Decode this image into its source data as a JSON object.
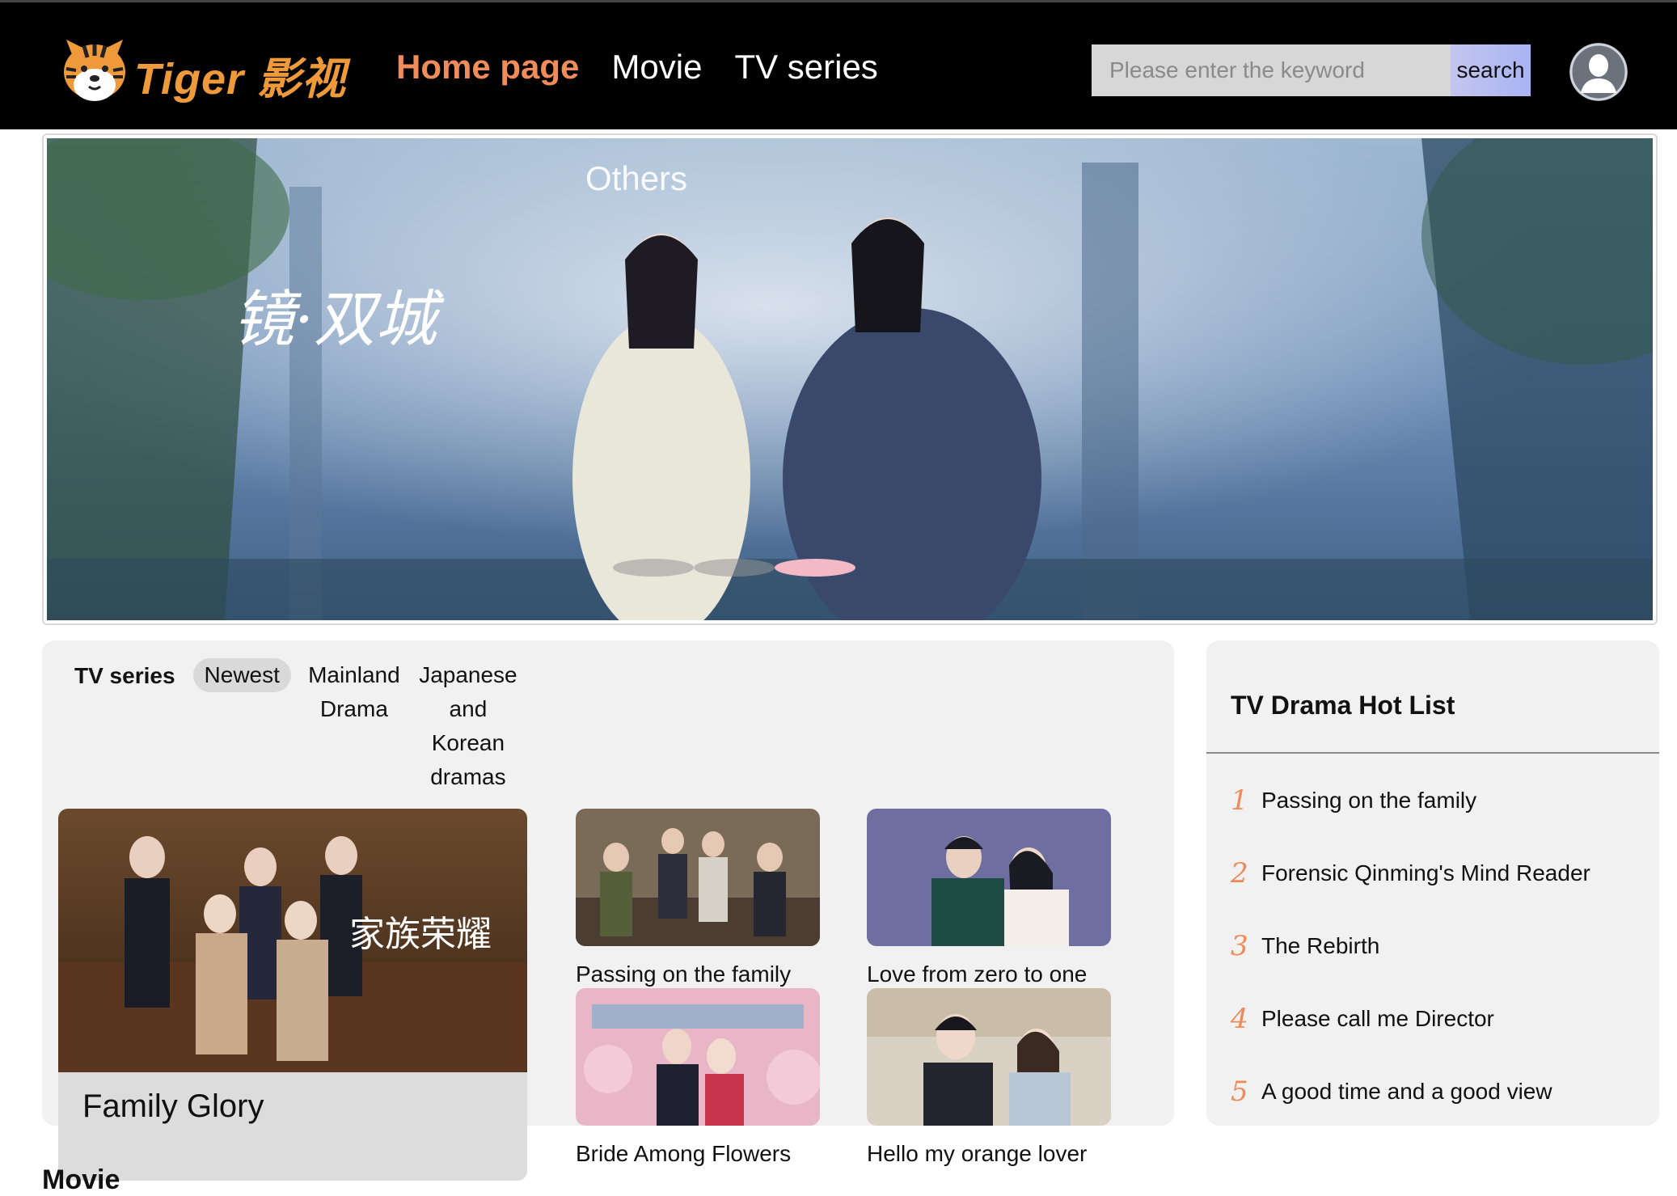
{
  "header": {
    "logo_text": "Tiger 影视",
    "nav": [
      {
        "label": "Home page",
        "active": true
      },
      {
        "label": "Movie",
        "active": false
      },
      {
        "label": "TV series",
        "active": false
      }
    ],
    "search": {
      "placeholder": "Please enter the keyword",
      "button_label": "search"
    }
  },
  "banner": {
    "label": "Others",
    "slide_count": 3,
    "active_slide": 3
  },
  "tv_section": {
    "title": "TV series",
    "tabs": [
      {
        "label": "Newest",
        "selected": true
      },
      {
        "label": "Mainland Drama",
        "selected": false
      },
      {
        "label": "Japanese and Korean dramas",
        "selected": false
      }
    ],
    "featured": {
      "title": "Family Glory"
    },
    "items": [
      {
        "title": "Passing on the family"
      },
      {
        "title": "Love from zero to one"
      },
      {
        "title": "Bride Among Flowers"
      },
      {
        "title": "Hello my orange lover"
      }
    ]
  },
  "hot_list": {
    "title": "TV Drama Hot List",
    "items": [
      {
        "rank": "1",
        "title": "Passing on the family"
      },
      {
        "rank": "2",
        "title": "Forensic Qinming's Mind Reader"
      },
      {
        "rank": "3",
        "title": "The Rebirth"
      },
      {
        "rank": "4",
        "title": "Please call me Director"
      },
      {
        "rank": "5",
        "title": "A good time and a good view"
      }
    ]
  },
  "movie_section": {
    "title": "Movie"
  },
  "colors": {
    "accent": "#f08c5a",
    "logo": "#ef9a3a",
    "rank": "#ef8a5a",
    "active_dot": "#f3b9c4"
  }
}
